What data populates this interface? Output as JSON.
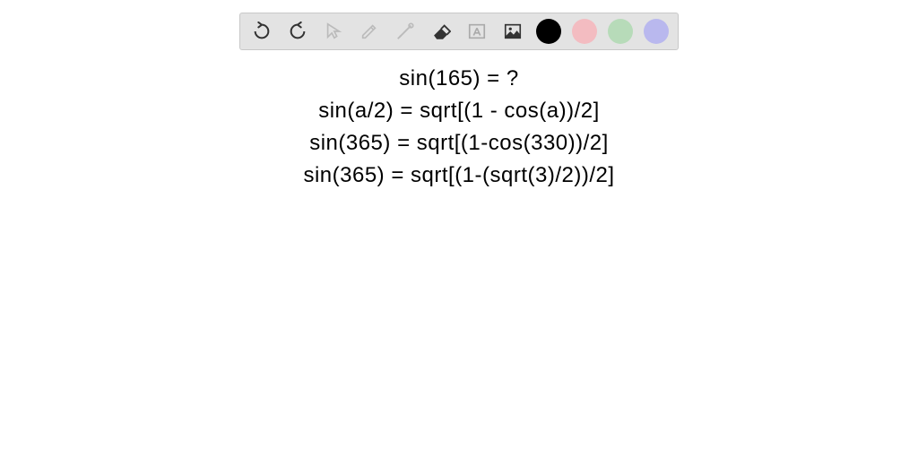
{
  "toolbar": {
    "icons": {
      "undo": "undo",
      "redo": "redo",
      "pointer": "pointer",
      "pencil": "pencil",
      "tools": "tools",
      "eraser": "eraser",
      "textbox": "textbox",
      "image": "image"
    },
    "colors": {
      "black": "#000000",
      "pink": "#f3bcc1",
      "green": "#b7dbb9",
      "purple": "#b9b8ee"
    }
  },
  "content": {
    "lines": [
      "sin(165) = ?",
      "sin(a/2) = sqrt[(1 - cos(a))/2]",
      "sin(365) = sqrt[(1-cos(330))/2]",
      "sin(365) = sqrt[(1-(sqrt(3)/2))/2]"
    ]
  }
}
